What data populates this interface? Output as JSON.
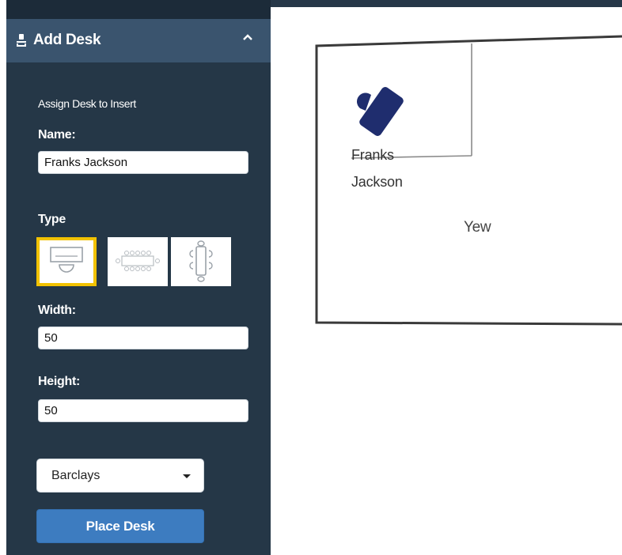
{
  "sidebar": {
    "panel_title": "Add Desk",
    "section_title": "Assign Desk to Insert",
    "name_label": "Name:",
    "name_value": "Franks Jackson",
    "type_label": "Type",
    "type_options": [
      "single-desk-icon",
      "long-table-icon",
      "round-table-icon"
    ],
    "type_selected": "single-desk-icon",
    "width_label": "Width:",
    "width_value": "50",
    "height_label": "Height:",
    "height_value": "50",
    "location_selected": "Barclays",
    "place_button": "Place Desk"
  },
  "floorplan": {
    "desk_name_line1": "Franks",
    "desk_name_line2": "Jackson",
    "room_name": "Yew"
  },
  "colors": {
    "sidebar_bg": "#253747",
    "header_bg": "#3a546e",
    "selected_border": "#f2c200",
    "primary_button": "#3d7cc0",
    "desk_marker": "#1f2d6e"
  }
}
